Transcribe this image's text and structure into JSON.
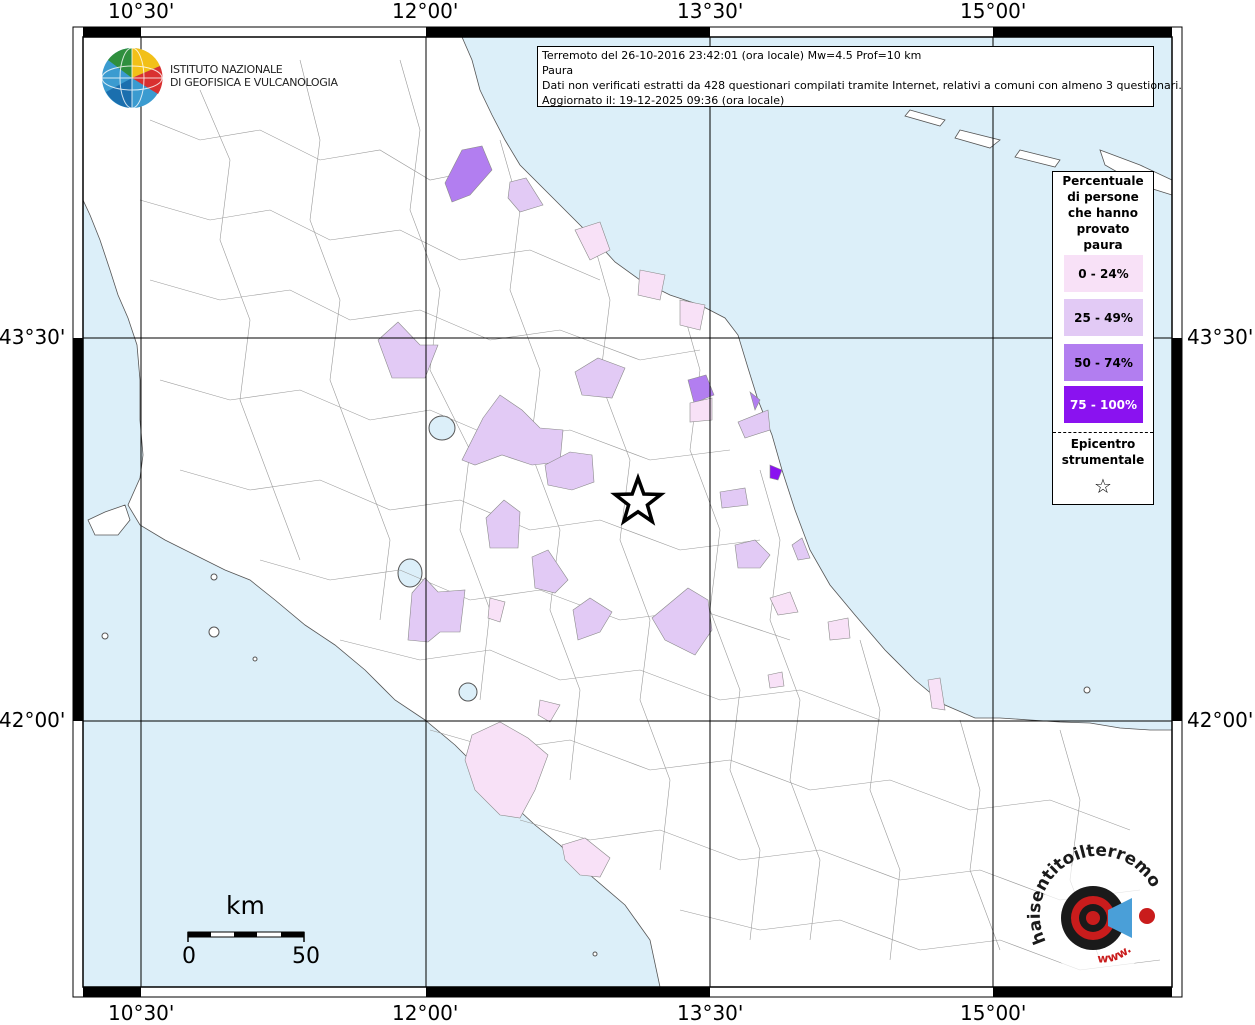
{
  "header": {
    "line1": "Terremoto del 26-10-2016 23:42:01 (ora locale) Mw=4.5 Prof=10 km",
    "line2": "Paura",
    "line3": "Dati non verificati estratti da 428 questionari compilati tramite Internet, relativi a comuni con almeno 3 questionari.",
    "line4": "Aggiornato il: 19-12-2025 09:36 (ora locale)"
  },
  "logo": {
    "line1": "ISTITUTO NAZIONALE",
    "line2": "DI GEOFISICA E VULCANOLOGIA",
    "badge_text": "haisentitoilterremoto.it",
    "badge_www": "www."
  },
  "legend": {
    "title_lines": [
      "Percentuale",
      "di persone",
      "che hanno",
      "provato",
      "paura"
    ],
    "items": [
      {
        "label": "0 - 24%",
        "color": "#f8e1f7",
        "text_color": "#000000"
      },
      {
        "label": "25 - 49%",
        "color": "#e2caf5",
        "text_color": "#000000"
      },
      {
        "label": "50 - 74%",
        "color": "#b27ef0",
        "text_color": "#000000"
      },
      {
        "label": "75 - 100%",
        "color": "#8a12f0",
        "text_color": "#ffffff"
      }
    ],
    "epicenter_lines": [
      "Epicentro",
      "strumentale"
    ]
  },
  "axes": {
    "top_labels": [
      "10°30'",
      "12°00'",
      "13°30'",
      "15°00'"
    ],
    "bottom_labels": [
      "10°30'",
      "12°00'",
      "13°30'",
      "15°00'"
    ],
    "left_labels": [
      "43°30'",
      "42°00'"
    ],
    "right_labels": [
      "43°30'",
      "42°00'"
    ]
  },
  "scale_bar": {
    "unit": "km",
    "min_label": "0",
    "max_label": "50"
  },
  "colors": {
    "sea": "#dceff9",
    "land": "#ffffff",
    "border": "#000000"
  },
  "epicenter": {
    "lon": 13.13,
    "lat": 42.88
  }
}
